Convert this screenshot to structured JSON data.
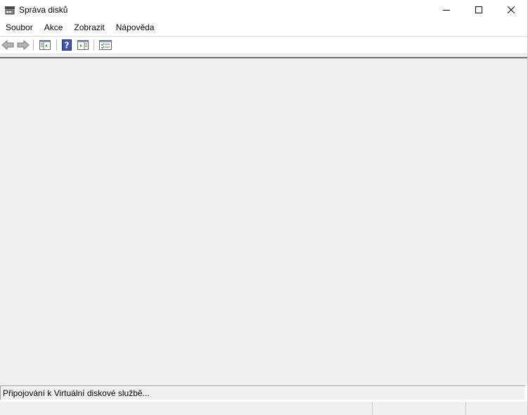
{
  "window": {
    "title": "Správa disků",
    "app_icon": "disk-management-icon"
  },
  "menu": {
    "items": [
      {
        "label": "Soubor"
      },
      {
        "label": "Akce"
      },
      {
        "label": "Zobrazit"
      },
      {
        "label": "Nápověda"
      }
    ]
  },
  "toolbar": {
    "icons": [
      "back-arrow-icon",
      "forward-arrow-icon",
      "show-hide-console-tree-icon",
      "help-icon",
      "show-hide-action-pane-icon",
      "properties-icon"
    ]
  },
  "status": {
    "text": "Připojování k Virtuální diskové službě..."
  }
}
